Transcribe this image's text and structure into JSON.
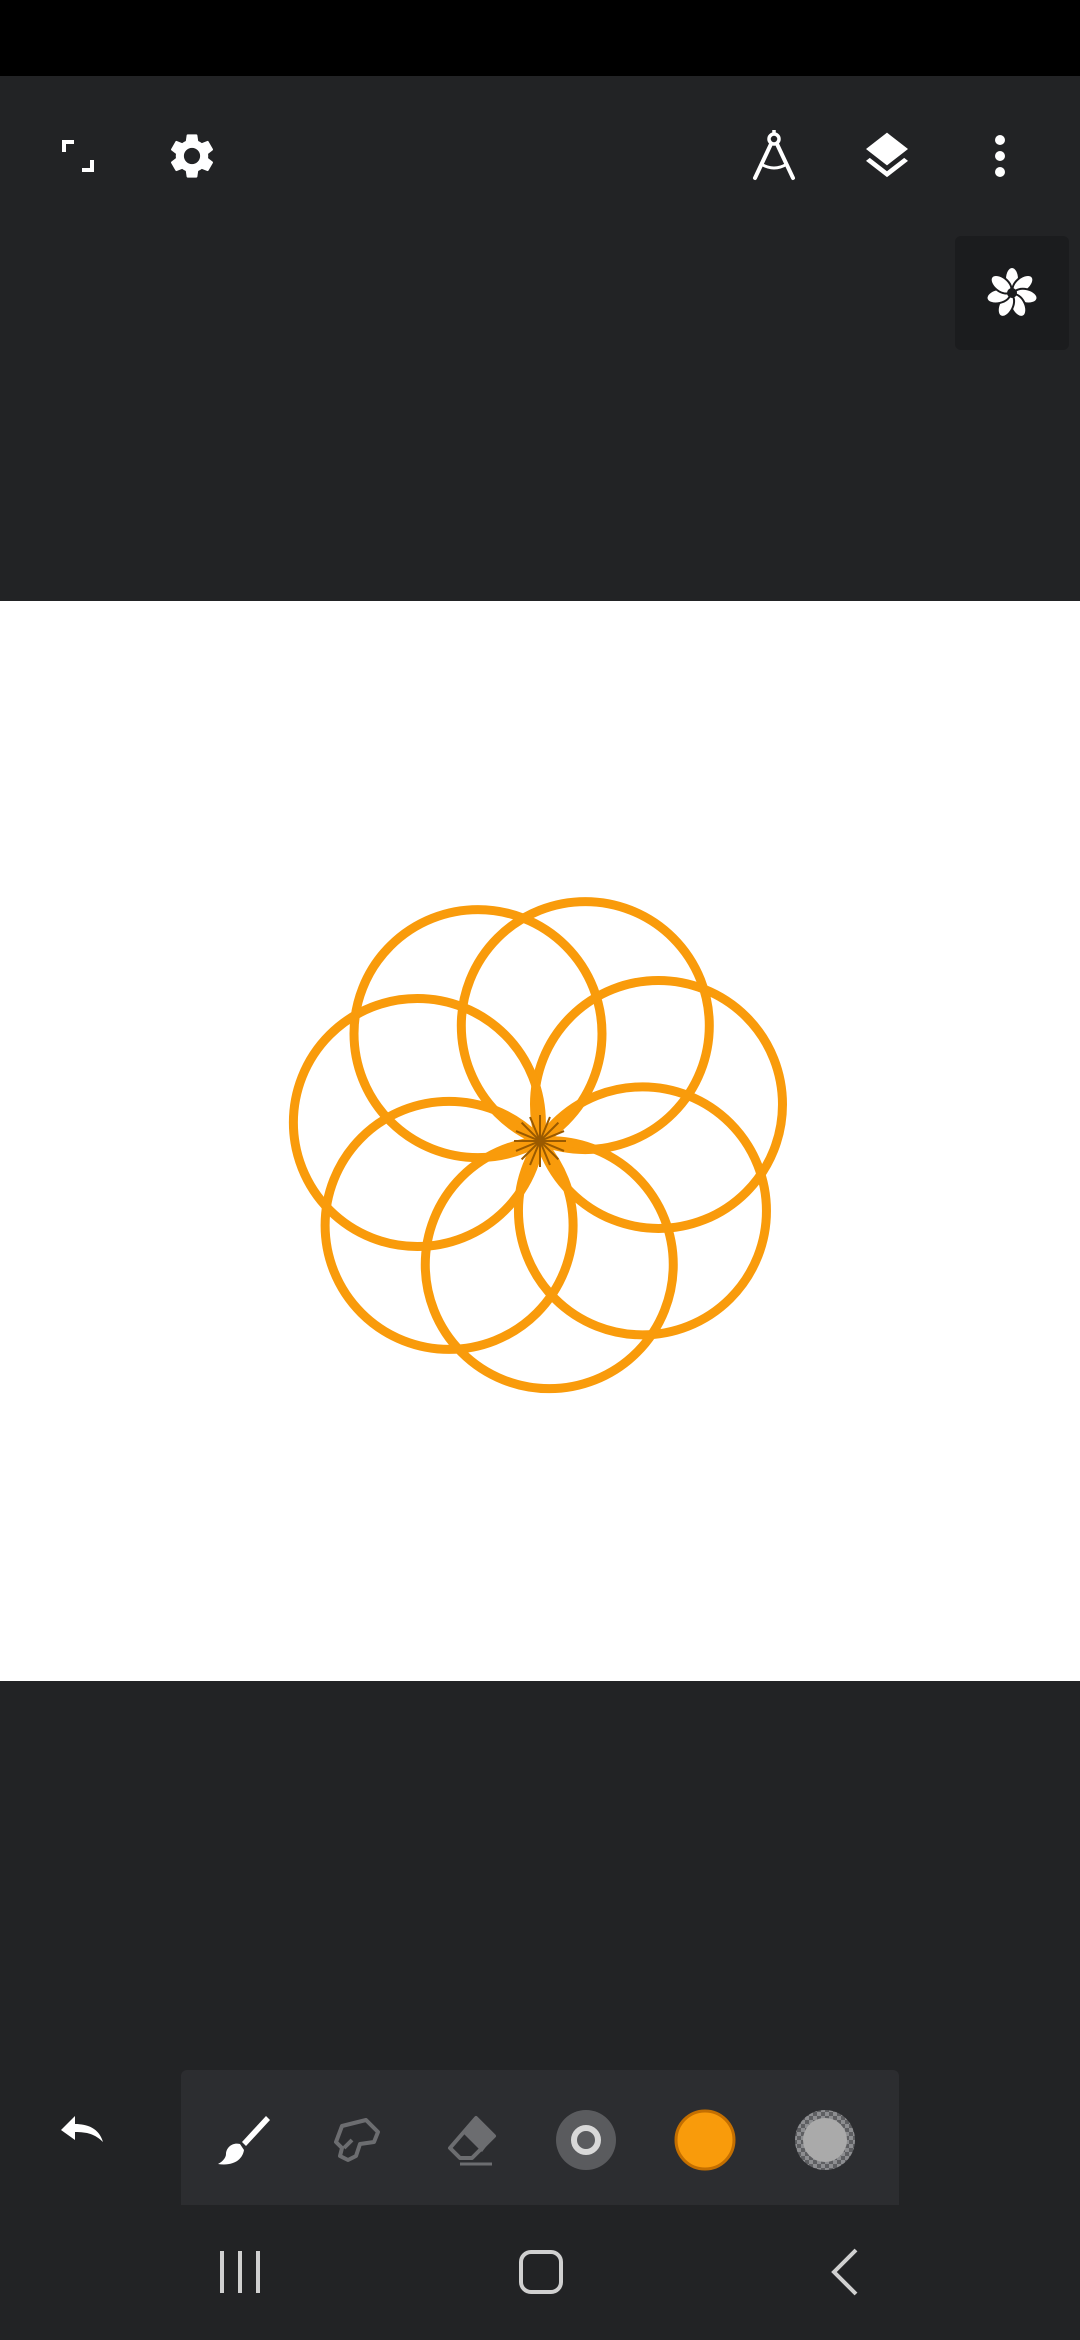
{
  "app": {
    "name": "drawing-canvas"
  },
  "colors": {
    "background": "#222325",
    "status_bar": "#000000",
    "canvas": "#ffffff",
    "stroke": "#f99b0b",
    "toolbar": "#2c2d30",
    "icon": "#ffffff",
    "icon_dim": "#6c6d70",
    "brush_size_bg": "#5a5b5e",
    "opacity_swatch": "#aaaaaa"
  },
  "topbar": {
    "icons": [
      "fullscreen-icon",
      "settings-icon",
      "ruler-compass-icon",
      "layers-icon",
      "more-vert-icon"
    ]
  },
  "symmetry": {
    "icon": "flower-symmetry-icon",
    "petals": 7
  },
  "drawing": {
    "shape": "rotated-circles",
    "count": 7,
    "stroke_color": "#f99b0b"
  },
  "toolbar": {
    "tools": [
      "brush-icon",
      "smudge-icon",
      "eraser-icon",
      "brush-size-icon",
      "color-swatch-icon",
      "opacity-swatch-icon"
    ],
    "active_color": "#f99b0b"
  },
  "navigation": {
    "icons": [
      "recent-apps-icon",
      "home-icon",
      "back-icon"
    ]
  }
}
